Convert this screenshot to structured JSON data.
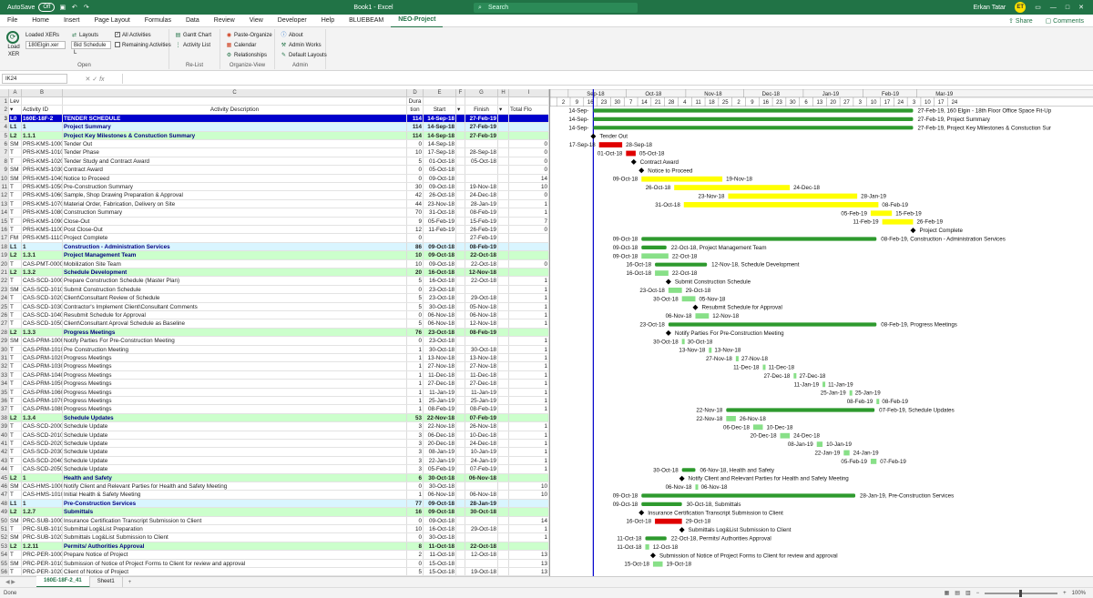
{
  "titlebar": {
    "autosave_label": "AutoSave",
    "autosave_state": "Off",
    "book_title": "Book1 - Excel",
    "search_placeholder": "Search",
    "user_name": "Erkan Tatar",
    "user_initials": "ET"
  },
  "menu": {
    "items": [
      "File",
      "Home",
      "Insert",
      "Page Layout",
      "Formulas",
      "Data",
      "Review",
      "View",
      "Developer",
      "Help",
      "BLUEBEAM",
      "NEO-Project"
    ],
    "active": "NEO-Project",
    "share": "Share",
    "comments": "Comments"
  },
  "ribbon": {
    "load_xer": "Load XER",
    "loaded_xers": "Loaded XERs",
    "xer_file": "180Elgin.xer",
    "layouts": "Layouts",
    "layout_value": "Bid Schedule L",
    "all_activities": "All Activities",
    "remaining_activities": "Remaining Activities",
    "open_group": "Open",
    "gantt_chart": "Gantt Chart",
    "activity_list": "Activity List",
    "relist_group": "Re-List",
    "paste_organize": "Paste-Organize",
    "calendar": "Calendar",
    "relationships": "Relationships",
    "organize_group": "Organize-View",
    "about": "About",
    "admin_works": "Admin Works",
    "default_layouts": "Default Layouts",
    "admin_group": "Admin"
  },
  "formula_bar": {
    "name_box": "IK24",
    "fx": "fx",
    "value": ""
  },
  "columns": {
    "letters": [
      "A",
      "B",
      "C",
      "D",
      "E",
      "F",
      "G",
      "H",
      "I"
    ],
    "row1": [
      "Lev",
      "",
      "",
      "Dura",
      "",
      "",
      "",
      "",
      ""
    ],
    "row2": [
      "",
      "Activity ID",
      "Activity Description",
      "tion",
      "Start",
      "",
      "Finish",
      "",
      "Total Flo"
    ]
  },
  "gantt_header": {
    "months": [
      "Sep-18",
      "Oct-18",
      "Nov-18",
      "Dec-18",
      "Jan-19",
      "Feb-19",
      "Mar-19"
    ],
    "days": [
      "2",
      "9",
      "16",
      "23",
      "30",
      "7",
      "14",
      "21",
      "28",
      "4",
      "11",
      "18",
      "25",
      "2",
      "9",
      "16",
      "23",
      "30",
      "6",
      "13",
      "20",
      "27",
      "3",
      "10",
      "17",
      "24",
      "3",
      "10",
      "17",
      "24"
    ]
  },
  "rows": [
    {
      "n": "3",
      "lv": "L0",
      "id": "160E-18F-2",
      "desc": "TENDER SCHEDULE",
      "dur": "114",
      "start": "14-Sep-18",
      "finish": "27-Feb-19",
      "tf": "",
      "type": "lv0"
    },
    {
      "n": "4",
      "lv": "L1",
      "id": "1",
      "desc": "Project Summary",
      "dur": "114",
      "start": "14-Sep-18",
      "finish": "27-Feb-19",
      "tf": "",
      "type": "lv1"
    },
    {
      "n": "5",
      "lv": "L2",
      "id": "1.1.1",
      "desc": "Project Key Milestones & Constuction Summary",
      "dur": "114",
      "start": "14-Sep-18",
      "finish": "27-Feb-19",
      "tf": "",
      "type": "lv2"
    },
    {
      "n": "6",
      "lv": "SM",
      "id": "PRS-KMS-1000",
      "desc": "Tender Out",
      "dur": "0",
      "start": "14-Sep-18",
      "finish": "",
      "tf": "0",
      "type": ""
    },
    {
      "n": "7",
      "lv": "T",
      "id": "PRS-KMS-1010",
      "desc": "Tender Phase",
      "dur": "10",
      "start": "17-Sep-18",
      "finish": "28-Sep-18",
      "tf": "0",
      "type": ""
    },
    {
      "n": "8",
      "lv": "T",
      "id": "PRS-KMS-1020",
      "desc": "Tender Study and Contract Award",
      "dur": "5",
      "start": "01-Oct-18",
      "finish": "05-Oct-18",
      "tf": "0",
      "type": ""
    },
    {
      "n": "9",
      "lv": "SM",
      "id": "PRS-KMS-1030",
      "desc": "Contract Award",
      "dur": "0",
      "start": "05-Oct-18",
      "finish": "",
      "tf": "0",
      "type": ""
    },
    {
      "n": "10",
      "lv": "SM",
      "id": "PRS-KMS-1040",
      "desc": "Notice to Proceed",
      "dur": "0",
      "start": "09-Oct-18",
      "finish": "",
      "tf": "14",
      "type": ""
    },
    {
      "n": "11",
      "lv": "T",
      "id": "PRS-KMS-1050",
      "desc": "Pre-Construction Summary",
      "dur": "30",
      "start": "09-Oct-18",
      "finish": "19-Nov-18",
      "tf": "10",
      "type": ""
    },
    {
      "n": "12",
      "lv": "T",
      "id": "PRS-KMS-1060",
      "desc": "Sample, Shop Drawing Preparation & Approval",
      "dur": "42",
      "start": "26-Oct-18",
      "finish": "24-Dec-18",
      "tf": "0",
      "type": ""
    },
    {
      "n": "13",
      "lv": "T",
      "id": "PRS-KMS-1070",
      "desc": "Material Order, Fabrication, Delivery on Site",
      "dur": "44",
      "start": "23-Nov-18",
      "finish": "28-Jan-19",
      "tf": "1",
      "type": ""
    },
    {
      "n": "14",
      "lv": "T",
      "id": "PRS-KMS-1080",
      "desc": "Construction Summary",
      "dur": "70",
      "start": "31-Oct-18",
      "finish": "08-Feb-19",
      "tf": "1",
      "type": ""
    },
    {
      "n": "15",
      "lv": "T",
      "id": "PRS-KMS-1090",
      "desc": "Close-Out",
      "dur": "9",
      "start": "05-Feb-19",
      "finish": "15-Feb-19",
      "tf": "7",
      "type": ""
    },
    {
      "n": "16",
      "lv": "T",
      "id": "PRS-KMS-1100",
      "desc": "Post Close-Out",
      "dur": "12",
      "start": "11-Feb-19",
      "finish": "26-Feb-19",
      "tf": "0",
      "type": ""
    },
    {
      "n": "17",
      "lv": "FM",
      "id": "PRS-KMS-1110",
      "desc": "Project Complete",
      "dur": "0",
      "start": "",
      "finish": "27-Feb-19",
      "tf": "",
      "type": ""
    },
    {
      "n": "18",
      "lv": "L1",
      "id": "1",
      "desc": "Construction - Administration Services",
      "dur": "86",
      "start": "09-Oct-18",
      "finish": "08-Feb-19",
      "tf": "",
      "type": "lv1"
    },
    {
      "n": "19",
      "lv": "L2",
      "id": "1.3.1",
      "desc": "Project Management Team",
      "dur": "10",
      "start": "09-Oct-18",
      "finish": "22-Oct-18",
      "tf": "",
      "type": "lv2"
    },
    {
      "n": "20",
      "lv": "T",
      "id": "CAS-PMT-0000",
      "desc": "Mobilization Site Team",
      "dur": "10",
      "start": "09-Oct-18",
      "finish": "22-Oct-18",
      "tf": "0",
      "type": ""
    },
    {
      "n": "21",
      "lv": "L2",
      "id": "1.3.2",
      "desc": "Schedule Development",
      "dur": "20",
      "start": "16-Oct-18",
      "finish": "12-Nov-18",
      "tf": "",
      "type": "lv2"
    },
    {
      "n": "22",
      "lv": "T",
      "id": "CAS-SCD-1000",
      "desc": "Prepare Construction Schedule (Master Plan)",
      "dur": "5",
      "start": "16-Oct-18",
      "finish": "22-Oct-18",
      "tf": "1",
      "type": ""
    },
    {
      "n": "23",
      "lv": "SM",
      "id": "CAS-SCD-1010",
      "desc": "Submit Construction Schedule",
      "dur": "0",
      "start": "23-Oct-18",
      "finish": "",
      "tf": "1",
      "type": ""
    },
    {
      "n": "24",
      "lv": "T",
      "id": "CAS-SCD-1020",
      "desc": "Client\\Consultant Review of Schedule",
      "dur": "5",
      "start": "23-Oct-18",
      "finish": "29-Oct-18",
      "tf": "1",
      "type": ""
    },
    {
      "n": "25",
      "lv": "T",
      "id": "CAS-SCD-1030",
      "desc": "Contractor's Implement Client\\Consultant Comments",
      "dur": "5",
      "start": "30-Oct-18",
      "finish": "05-Nov-18",
      "tf": "1",
      "type": ""
    },
    {
      "n": "26",
      "lv": "T",
      "id": "CAS-SCD-1040",
      "desc": "Resubmit Schedule for Approval",
      "dur": "0",
      "start": "06-Nov-18",
      "finish": "06-Nov-18",
      "tf": "1",
      "type": ""
    },
    {
      "n": "27",
      "lv": "T",
      "id": "CAS-SCD-1050",
      "desc": "Client\\Consultant Aproval Schedule as Baseline",
      "dur": "5",
      "start": "06-Nov-18",
      "finish": "12-Nov-18",
      "tf": "1",
      "type": ""
    },
    {
      "n": "28",
      "lv": "L2",
      "id": "1.3.3",
      "desc": "Progress Meetings",
      "dur": "76",
      "start": "23-Oct-18",
      "finish": "08-Feb-19",
      "tf": "",
      "type": "lv2"
    },
    {
      "n": "29",
      "lv": "SM",
      "id": "CAS-PRM-1000",
      "desc": "Notify Parties For Pre-Construction Meeting",
      "dur": "0",
      "start": "23-Oct-18",
      "finish": "",
      "tf": "1",
      "type": ""
    },
    {
      "n": "30",
      "lv": "T",
      "id": "CAS-PRM-1010",
      "desc": "Pre Construction Meeting",
      "dur": "1",
      "start": "30-Oct-18",
      "finish": "30-Oct-18",
      "tf": "1",
      "type": ""
    },
    {
      "n": "31",
      "lv": "T",
      "id": "CAS-PRM-1020",
      "desc": "Progress Meetings",
      "dur": "1",
      "start": "13-Nov-18",
      "finish": "13-Nov-18",
      "tf": "1",
      "type": ""
    },
    {
      "n": "32",
      "lv": "T",
      "id": "CAS-PRM-1030",
      "desc": "Progress Meetings",
      "dur": "1",
      "start": "27-Nov-18",
      "finish": "27-Nov-18",
      "tf": "1",
      "type": ""
    },
    {
      "n": "33",
      "lv": "T",
      "id": "CAS-PRM-1040",
      "desc": "Progress Meetings",
      "dur": "1",
      "start": "11-Dec-18",
      "finish": "11-Dec-18",
      "tf": "1",
      "type": ""
    },
    {
      "n": "34",
      "lv": "T",
      "id": "CAS-PRM-1050",
      "desc": "Progress Meetings",
      "dur": "1",
      "start": "27-Dec-18",
      "finish": "27-Dec-18",
      "tf": "1",
      "type": ""
    },
    {
      "n": "35",
      "lv": "T",
      "id": "CAS-PRM-1060",
      "desc": "Progress Meetings",
      "dur": "1",
      "start": "11-Jan-19",
      "finish": "11-Jan-19",
      "tf": "1",
      "type": ""
    },
    {
      "n": "36",
      "lv": "T",
      "id": "CAS-PRM-1070",
      "desc": "Progress Meetings",
      "dur": "1",
      "start": "25-Jan-19",
      "finish": "25-Jan-19",
      "tf": "1",
      "type": ""
    },
    {
      "n": "37",
      "lv": "T",
      "id": "CAS-PRM-1080",
      "desc": "Progress Meetings",
      "dur": "1",
      "start": "08-Feb-19",
      "finish": "08-Feb-19",
      "tf": "1",
      "type": ""
    },
    {
      "n": "38",
      "lv": "L2",
      "id": "1.3.4",
      "desc": "Schedule Updates",
      "dur": "53",
      "start": "22-Nov-18",
      "finish": "07-Feb-19",
      "tf": "",
      "type": "lv2"
    },
    {
      "n": "39",
      "lv": "T",
      "id": "CAS-SCD-2000",
      "desc": "Schedule Update",
      "dur": "3",
      "start": "22-Nov-18",
      "finish": "26-Nov-18",
      "tf": "1",
      "type": ""
    },
    {
      "n": "40",
      "lv": "T",
      "id": "CAS-SCD-2010",
      "desc": "Schedule Update",
      "dur": "3",
      "start": "06-Dec-18",
      "finish": "10-Dec-18",
      "tf": "1",
      "type": ""
    },
    {
      "n": "41",
      "lv": "T",
      "id": "CAS-SCD-2020",
      "desc": "Schedule Update",
      "dur": "3",
      "start": "20-Dec-18",
      "finish": "24-Dec-18",
      "tf": "1",
      "type": ""
    },
    {
      "n": "42",
      "lv": "T",
      "id": "CAS-SCD-2030",
      "desc": "Schedule Update",
      "dur": "3",
      "start": "08-Jan-19",
      "finish": "10-Jan-19",
      "tf": "1",
      "type": ""
    },
    {
      "n": "43",
      "lv": "T",
      "id": "CAS-SCD-2040",
      "desc": "Schedule Update",
      "dur": "3",
      "start": "22-Jan-19",
      "finish": "24-Jan-19",
      "tf": "1",
      "type": ""
    },
    {
      "n": "44",
      "lv": "T",
      "id": "CAS-SCD-2050",
      "desc": "Schedule Update",
      "dur": "3",
      "start": "05-Feb-19",
      "finish": "07-Feb-19",
      "tf": "1",
      "type": ""
    },
    {
      "n": "45",
      "lv": "L2",
      "id": "1",
      "desc": "Health and Safety",
      "dur": "6",
      "start": "30-Oct-18",
      "finish": "06-Nov-18",
      "tf": "",
      "type": "lv2"
    },
    {
      "n": "46",
      "lv": "SM",
      "id": "CAS-HMS-1000",
      "desc": "Notify Client and Relevant Parties for Health and Safety Meeting",
      "dur": "0",
      "start": "30-Oct-18",
      "finish": "",
      "tf": "10",
      "type": ""
    },
    {
      "n": "47",
      "lv": "T",
      "id": "CAS-HMS-1010",
      "desc": "Initial Health & Safety Meeting",
      "dur": "1",
      "start": "06-Nov-18",
      "finish": "06-Nov-18",
      "tf": "10",
      "type": ""
    },
    {
      "n": "48",
      "lv": "L1",
      "id": "1",
      "desc": "Pre-Construction Services",
      "dur": "77",
      "start": "09-Oct-18",
      "finish": "28-Jan-19",
      "tf": "",
      "type": "lv1"
    },
    {
      "n": "49",
      "lv": "L2",
      "id": "1.2.7",
      "desc": "Submittals",
      "dur": "16",
      "start": "09-Oct-18",
      "finish": "30-Oct-18",
      "tf": "",
      "type": "lv2"
    },
    {
      "n": "50",
      "lv": "SM",
      "id": "PRC-SUB-1000",
      "desc": "Insurance Certification Transcript Submission to Client",
      "dur": "0",
      "start": "09-Oct-18",
      "finish": "",
      "tf": "14",
      "type": ""
    },
    {
      "n": "51",
      "lv": "T",
      "id": "PRC-SUB-1010",
      "desc": "Submittal Log&List Preparation",
      "dur": "10",
      "start": "16-Oct-18",
      "finish": "29-Oct-18",
      "tf": "1",
      "type": ""
    },
    {
      "n": "52",
      "lv": "SM",
      "id": "PRC-SUB-1020",
      "desc": "Submittals Log&List Submission to Client",
      "dur": "0",
      "start": "30-Oct-18",
      "finish": "",
      "tf": "1",
      "type": ""
    },
    {
      "n": "53",
      "lv": "L2",
      "id": "1.2.11",
      "desc": "Permits/ Authorities Approval",
      "dur": "8",
      "start": "11-Oct-18",
      "finish": "22-Oct-18",
      "tf": "",
      "type": "lv2"
    },
    {
      "n": "54",
      "lv": "T",
      "id": "PRC-PER-1000",
      "desc": "Prepare Notice of Project",
      "dur": "2",
      "start": "11-Oct-18",
      "finish": "12-Oct-18",
      "tf": "13",
      "type": ""
    },
    {
      "n": "55",
      "lv": "SM",
      "id": "PRC-PER-1010",
      "desc": "Submission of Notice of Project Forms to Client for review and approval",
      "dur": "0",
      "start": "15-Oct-18",
      "finish": "",
      "tf": "13",
      "type": ""
    },
    {
      "n": "56",
      "lv": "T",
      "id": "PRC-PER-1020",
      "desc": "Client of Notice of Project",
      "dur": "5",
      "start": "15-Oct-18",
      "finish": "19-Oct-18",
      "tf": "13",
      "type": ""
    }
  ],
  "gantt_labels": {
    "r3": "27-Feb-19, 160 Elgin - 18th Floor Office Space Fit-Up",
    "r4": "27-Feb-19, Project Summary",
    "r5": "27-Feb-19, Project Key Milestones & Constuction Sur",
    "r18": "08-Feb-19, Construction - Administration Services",
    "r19": "22-Oct-18, Project Management Team",
    "r21": "12-Nov-18, Schedule Development",
    "r28": "08-Feb-19, Progress Meetings",
    "r38": "07-Feb-19, Schedule Updates",
    "r45": "06-Nov-18, Health and Safety",
    "r48": "28-Jan-19, Pre-Construction Services",
    "r49": "30-Oct-18, Submittals",
    "r53": "22-Oct-18, Permits/ Authorities Approval",
    "start_stub": "14-Sep-"
  },
  "colors": {
    "excel_green": "#217346",
    "summary_bar": "#2e9a2e",
    "critical_bar": "#e00000",
    "milestone_bar": "#ffff00",
    "normal_bar": "#88e088",
    "data_date_line": "#0000cc"
  },
  "sheets": {
    "tabs": [
      "160E-18F-2_41",
      "Sheet1"
    ],
    "active": "160E-18F-2_41",
    "add": "+"
  },
  "status": {
    "text": "Done",
    "zoom": "100%"
  }
}
